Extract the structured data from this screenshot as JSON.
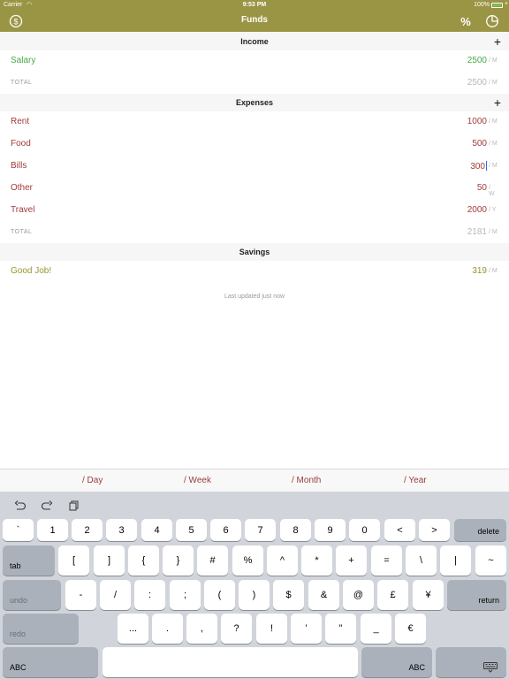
{
  "status": {
    "carrier": "Carrier",
    "time": "9:53 PM",
    "battery": "100%"
  },
  "nav": {
    "title": "Funds",
    "percent_symbol": "%"
  },
  "income": {
    "header": "Income",
    "add": "+",
    "items": [
      {
        "label": "Salary",
        "amount": "2500",
        "unit": "/ M"
      }
    ],
    "total": {
      "label": "TOTAL",
      "amount": "2500",
      "unit": "/ M"
    }
  },
  "expenses": {
    "header": "Expenses",
    "add": "+",
    "items": [
      {
        "label": "Rent",
        "amount": "1000",
        "unit": "/ M"
      },
      {
        "label": "Food",
        "amount": "500",
        "unit": "/ M"
      },
      {
        "label": "Bills",
        "amount": "300",
        "unit": "/ M"
      },
      {
        "label": "Other",
        "amount": "50",
        "unit": "/ W"
      },
      {
        "label": "Travel",
        "amount": "2000",
        "unit": "/ Y"
      }
    ],
    "total": {
      "label": "TOTAL",
      "amount": "2181",
      "unit": "/ M"
    }
  },
  "savings": {
    "header": "Savings",
    "items": [
      {
        "label": "Good Job!",
        "amount": "319",
        "unit": "/ M"
      }
    ]
  },
  "last_updated": "Last updated just now",
  "period_bar": {
    "day": "/ Day",
    "week": "/ Week",
    "month": "/ Month",
    "year": "/ Year"
  },
  "keyboard": {
    "row1": [
      "`",
      "1",
      "2",
      "3",
      "4",
      "5",
      "6",
      "7",
      "8",
      "9",
      "0",
      "<",
      ">"
    ],
    "delete": "delete",
    "tab": "tab",
    "row2": [
      "[",
      "]",
      "{",
      "}",
      "#",
      "%",
      "^",
      "*",
      "+",
      "=",
      "\\",
      "|",
      "~"
    ],
    "undo": "undo",
    "row3": [
      "-",
      "/",
      ":",
      ";",
      "(",
      ")",
      "$",
      "&",
      "@",
      "£",
      "¥"
    ],
    "return": "return",
    "redo": "redo",
    "row4": [
      "...",
      ".",
      ",",
      "?",
      "!",
      "’",
      "”",
      "_",
      "€"
    ],
    "abc_left": "ABC",
    "abc_right": "ABC"
  },
  "colors": {
    "nav": "#9a9545",
    "income": "#48a947",
    "expense": "#a33a3a",
    "savings": "#9a9434"
  }
}
